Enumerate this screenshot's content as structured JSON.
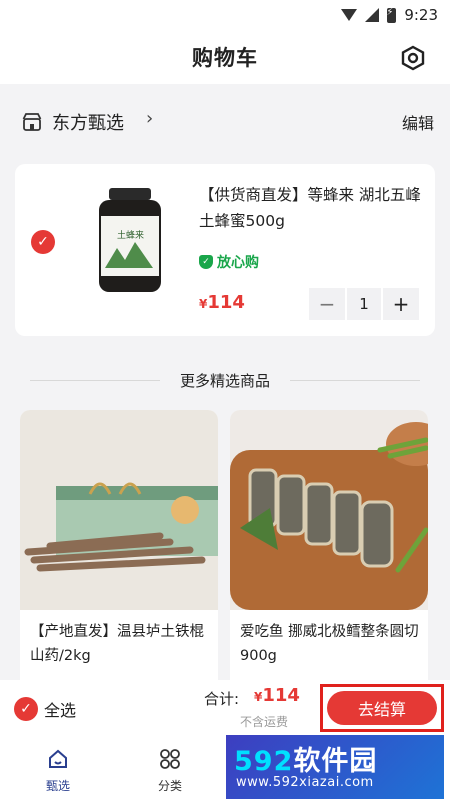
{
  "status_bar": {
    "time": "9:23"
  },
  "header": {
    "title": "购物车"
  },
  "store": {
    "name": "东方甄选",
    "edit_label": "编辑"
  },
  "cart_item": {
    "title": "【供货商直发】等蜂来 湖北五峰 土蜂蜜500g",
    "badge": "放心购",
    "price_symbol": "¥",
    "price": "114",
    "quantity": "1",
    "minus": "−",
    "plus": "+",
    "jar_label": "土蜂来"
  },
  "recommend": {
    "heading": "更多精选商品",
    "items": [
      {
        "title": "【产地直发】温县垆土铁棍山药/2kg"
      },
      {
        "title": "爱吃鱼 挪威北极鳕整条圆切 900g"
      }
    ]
  },
  "checkout": {
    "select_all": "全选",
    "total_label": "合计:",
    "total_symbol": "¥",
    "total_value": "114",
    "shipping_note": "不含运费",
    "button": "去结算"
  },
  "tabs": [
    {
      "label": "甄选"
    },
    {
      "label": "分类"
    }
  ],
  "watermark": {
    "main_prefix": "592",
    "main_suffix": "软件园",
    "url": "www.592xiazai.com"
  },
  "colors": {
    "accent": "#e53935",
    "badge_green": "#1aa64b",
    "tab_active": "#2a3f8f"
  }
}
